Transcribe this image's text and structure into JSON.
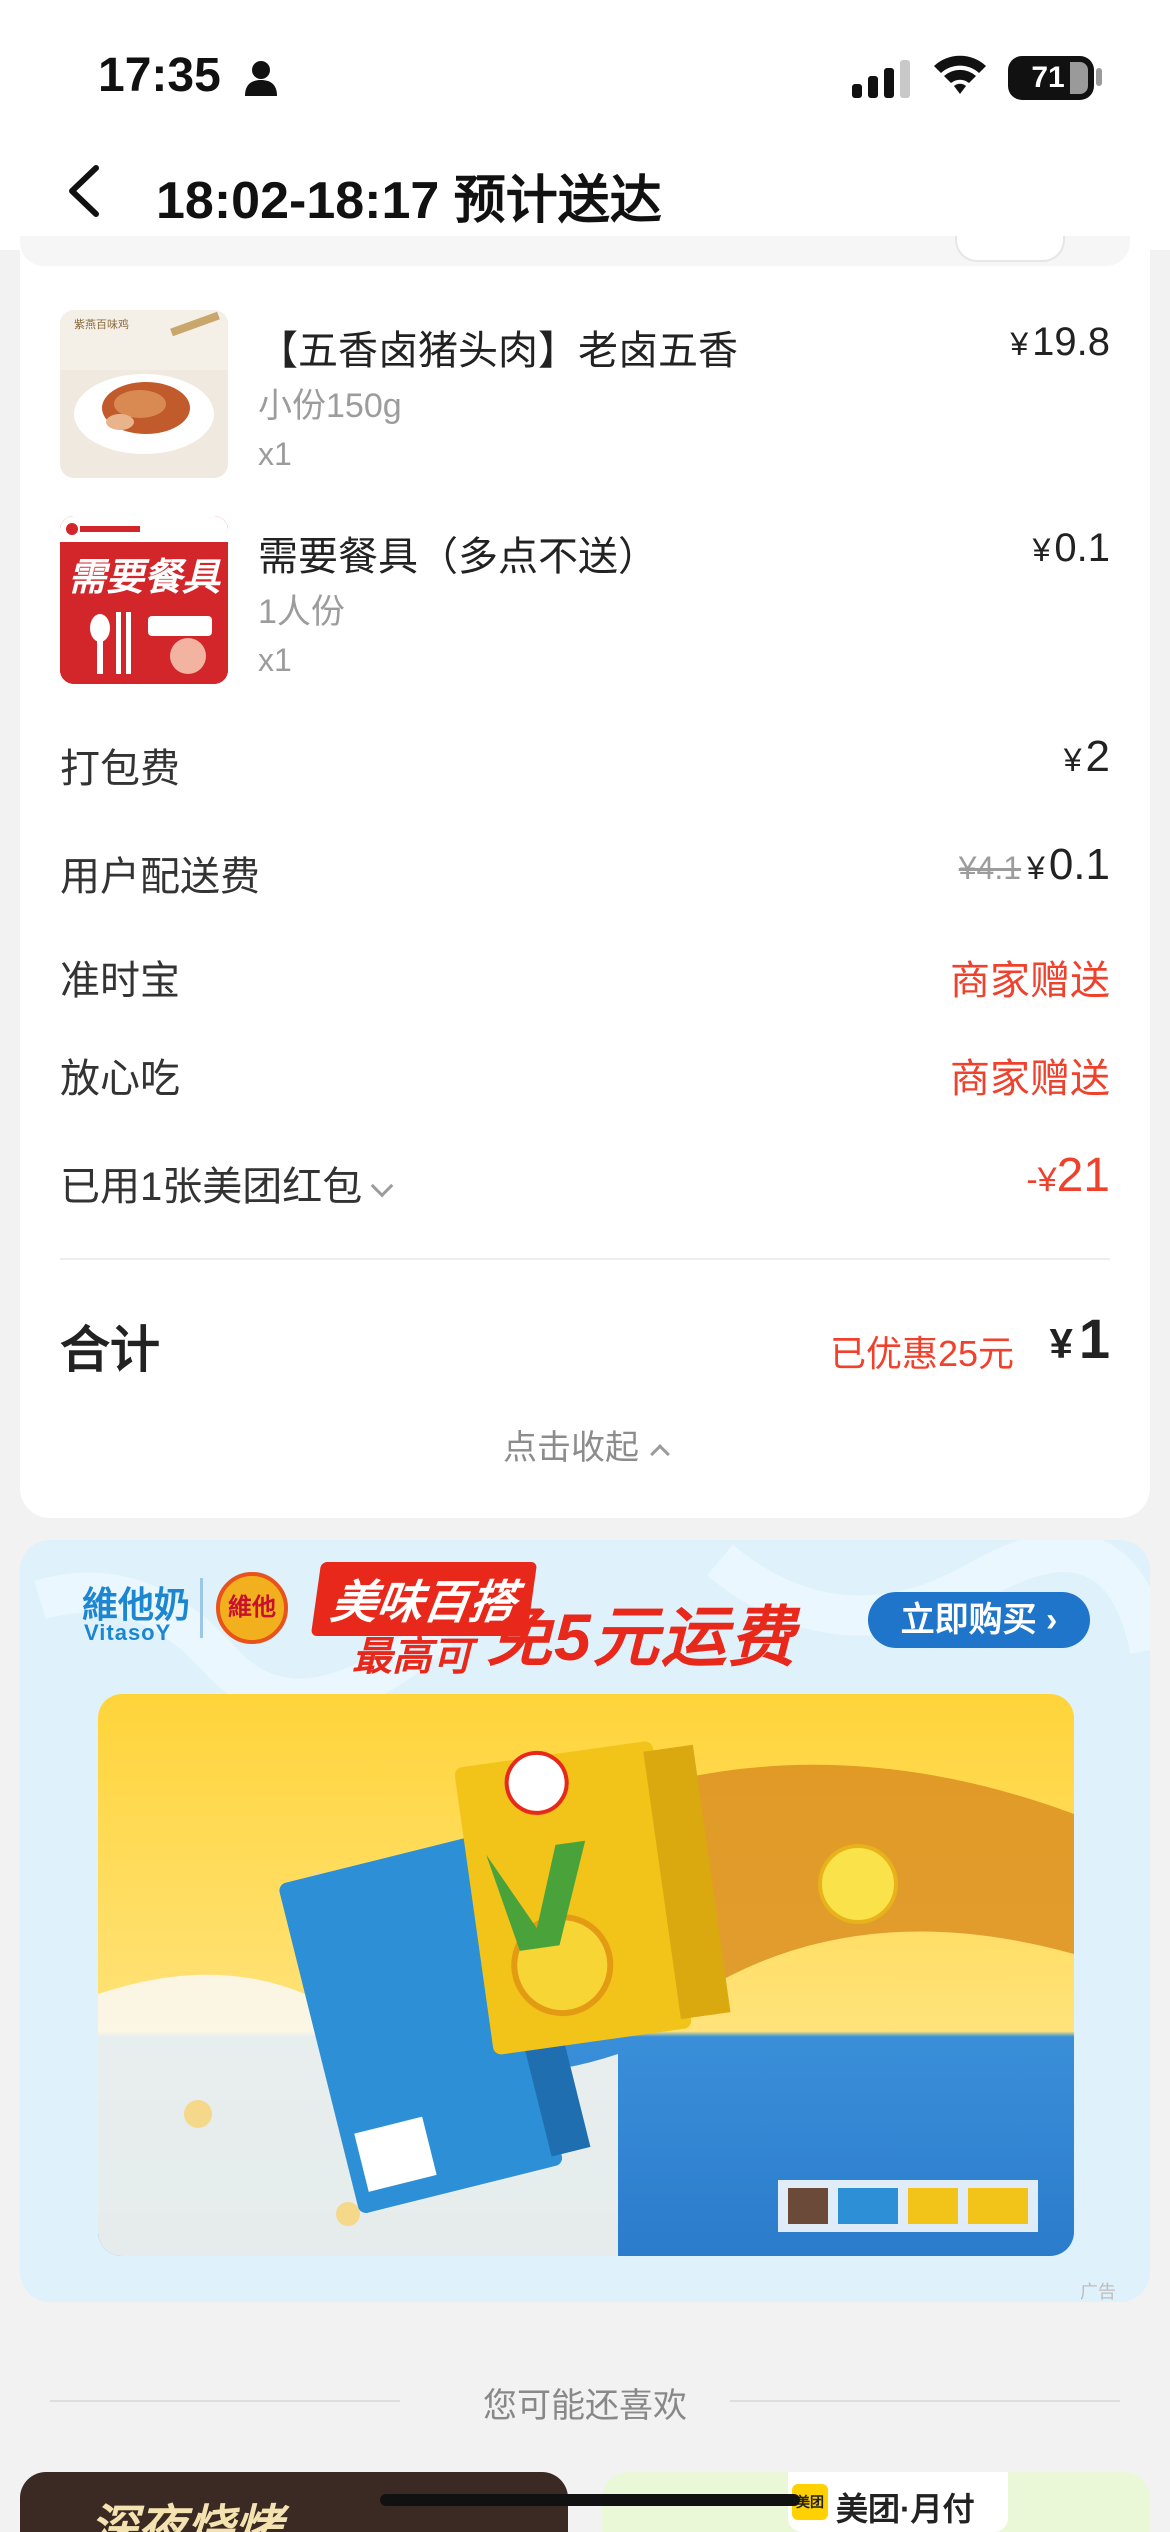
{
  "status_bar": {
    "time": "17:35",
    "battery": "71"
  },
  "nav": {
    "title": "18:02-18:17 预计送达"
  },
  "items": [
    {
      "name": "【五香卤猪头肉】老卤五香",
      "spec": "小份150g",
      "qty": "x1",
      "currency": "¥",
      "price": "19.8"
    },
    {
      "name": "需要餐具（多点不送）",
      "spec": "1人份",
      "qty": "x1",
      "currency": "¥",
      "price": "0.1",
      "thumb_text": "需要餐具"
    }
  ],
  "fees": {
    "packing_label": "打包费",
    "packing_currency": "¥",
    "packing_value": "2",
    "delivery_label": "用户配送费",
    "delivery_original": "¥4.1",
    "delivery_currency": "¥",
    "delivery_value": "0.1",
    "ontime_label": "准时宝",
    "ontime_value": "商家赠送",
    "safe_label": "放心吃",
    "safe_value": "商家赠送",
    "redpacket_label": "已用1张美团红包",
    "redpacket_value": "21",
    "redpacket_prefix": "-¥"
  },
  "total": {
    "label": "合计",
    "discount": "已优惠25元",
    "currency": "¥",
    "value": "1"
  },
  "collapse_label": "点击收起",
  "ad": {
    "brand": "維他奶",
    "brand_en": "VitasoY",
    "logo_text": "維他",
    "slogan_1": "美味百搭",
    "slogan_2": "最高可",
    "slogan_3": "免5元运费",
    "button": "立即购买",
    "mark": "广告"
  },
  "recommend": {
    "title": "您可能还喜欢",
    "left_card_text": "深夜烧烤",
    "right_card_logo": "美团",
    "right_card_text": "美团·月付"
  },
  "colors": {
    "accent_red": "#f0412d",
    "ad_blue": "#1e75c9"
  }
}
